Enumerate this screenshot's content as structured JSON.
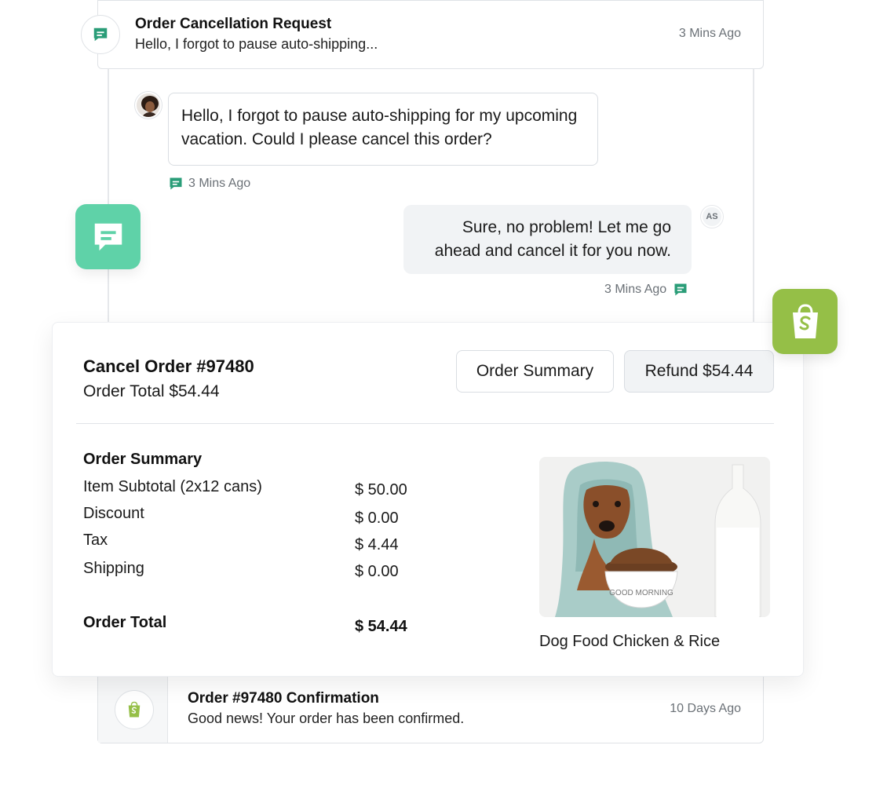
{
  "thread_header": {
    "title": "Order Cancellation Request",
    "preview": "Hello, I forgot to pause auto-shipping...",
    "time": "3 Mins Ago"
  },
  "messages": [
    {
      "direction": "incoming",
      "text": "Hello, I forgot to pause auto-shipping for my upcoming vacation. Could I please cancel this order?",
      "time": "3 Mins Ago"
    },
    {
      "direction": "outgoing",
      "sender_initials": "AS",
      "text": "Sure, no problem! Let me go ahead and cancel it for you now.",
      "time": "3 Mins Ago"
    }
  ],
  "order_card": {
    "title": "Cancel Order #97480",
    "order_total_line": "Order Total $54.44",
    "buttons": {
      "summary_label": "Order Summary",
      "refund_label": "Refund $54.44"
    },
    "summary": {
      "heading": "Order Summary",
      "rows": [
        {
          "label": "Item Subtotal (2x12 cans)",
          "value": "$ 50.00"
        },
        {
          "label": "Discount",
          "value": "$ 0.00"
        },
        {
          "label": "Tax",
          "value": "$ 4.44"
        },
        {
          "label": "Shipping",
          "value": "$ 0.00"
        }
      ],
      "total_label": "Order Total",
      "total_value": "$ 54.44"
    },
    "product": {
      "name": "Dog Food Chicken & Rice",
      "bowl_text": "GOOD MORNING"
    }
  },
  "confirmation": {
    "title": "Order #97480 Confirmation",
    "text": "Good news! Your order has been confirmed.",
    "time": "10 Days Ago"
  },
  "colors": {
    "chat_icon_green": "#2a9d78",
    "chat_tile_green": "#5fd2a8",
    "shopify_green": "#95bf47",
    "muted_text": "#6b7177"
  },
  "icons": {
    "chat": "chat-bubble-icon",
    "shopify": "shopify-bag-icon"
  }
}
